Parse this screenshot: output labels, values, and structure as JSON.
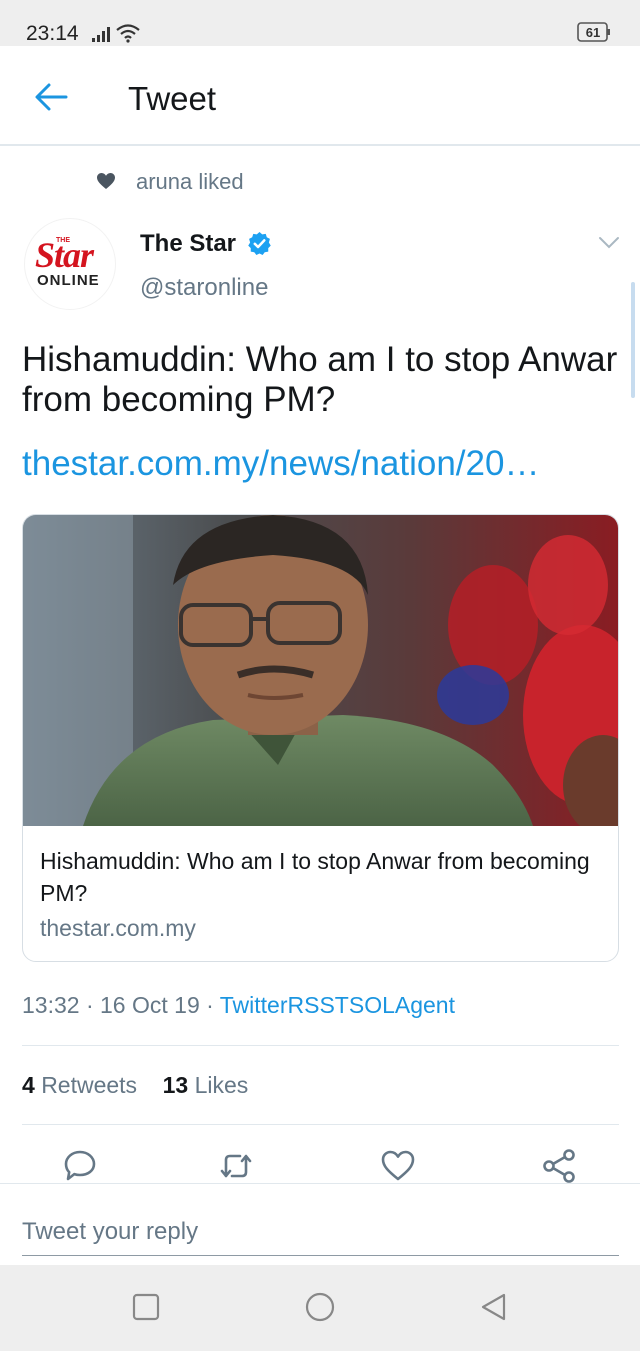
{
  "status_bar": {
    "time": "23:14",
    "battery": "61",
    "icons": [
      "signal-icon",
      "wifi-icon",
      "battery-icon"
    ]
  },
  "header": {
    "title": "Tweet",
    "back_icon": "arrow-left-icon"
  },
  "social_context": {
    "icon": "heart-icon",
    "text": "aruna liked"
  },
  "author": {
    "name": "The Star",
    "handle": "@staronline",
    "verified": true,
    "avatar_logo": {
      "the": "THE",
      "star": "Star",
      "online": "ONLINE"
    }
  },
  "tweet": {
    "text": "Hishamuddin: Who am I to stop Anwar from becoming PM?",
    "link": "thestar.com.my/news/nation/20…",
    "meta": {
      "time": "13:32",
      "date": "16 Oct 19",
      "source": "TwitterRSSTSOLAgent"
    }
  },
  "card": {
    "title": "Hishamuddin: Who am I to stop Anwar from becoming PM?",
    "domain": "thestar.com.my"
  },
  "stats": {
    "retweets_count": "4",
    "retweets_label": "Retweets",
    "likes_count": "13",
    "likes_label": "Likes"
  },
  "actions": [
    "reply-icon",
    "retweet-icon",
    "like-icon",
    "share-icon"
  ],
  "reply": {
    "placeholder": "Tweet your reply"
  },
  "nav": [
    "recents-icon",
    "home-icon",
    "back-icon"
  ],
  "colors": {
    "accent": "#1b95e0",
    "secondary_text": "#657786",
    "primary_text": "#14171a",
    "brand_red": "#d4141f"
  }
}
